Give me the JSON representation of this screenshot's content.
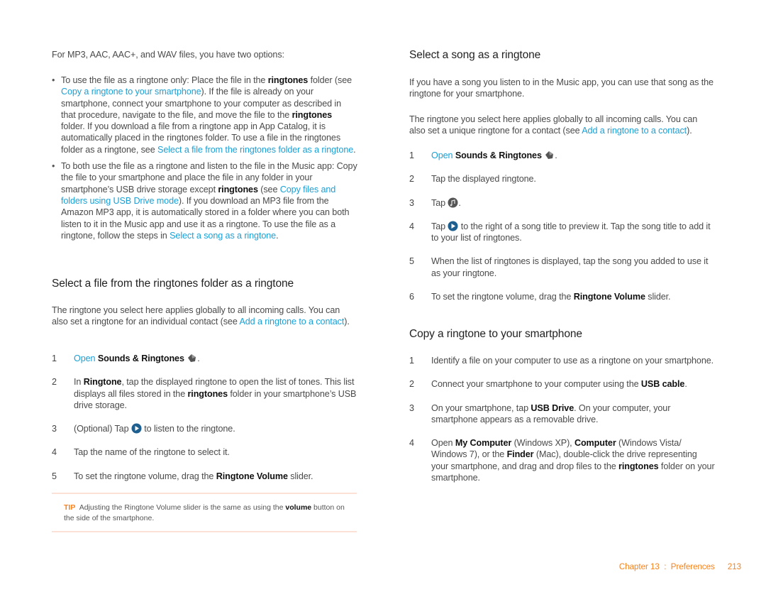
{
  "left": {
    "intro": "For MP3, AAC, AAC+, and WAV files, you have two options:",
    "bullet1": {
      "t1": "To use the file as a ringtone only: Place the file in the ",
      "b1": "ringtones",
      "t2": " folder (see ",
      "link1": "Copy a ringtone to your smartphone",
      "t3": "). If the file is already on your smartphone, connect your smartphone to your computer as described in that procedure, navigate to the file, and move the file to the ",
      "b2": "ringtones",
      "t4": " folder. If you download a file from a ringtone app in App Catalog, it is automatically placed in the ringtones folder. To use a file in the ringtones folder as a ringtone, see ",
      "link2": "Select a file from the ringtones folder as a ringtone",
      "t5": "."
    },
    "bullet2": {
      "t1": "To both use the file as a ringtone and listen to the file in the Music app: Copy the file to your smartphone and place the file in any folder in your smartphone’s USB drive storage except ",
      "b1": "ringtones",
      "t2": " (see ",
      "link1": "Copy files and folders using USB Drive mode",
      "t3": "). If you download an MP3 file from the Amazon MP3 app, it is automatically stored in a folder where you can both listen to it in the Music app and use it as a ringtone. To use the file as a ringtone, follow the steps in ",
      "link2": "Select a song as a ringtone",
      "t4": "."
    },
    "section_title": "Select a file from the ringtones folder as a ringtone",
    "section_para": {
      "t1": "The ringtone you select here applies globally to all incoming calls. You can also set a ringtone for an individual contact (see ",
      "link": "Add a ringtone to a contact",
      "t2": ")."
    },
    "steps": {
      "s1": {
        "num": "1",
        "link": "Open",
        "b": "Sounds & Ringtones",
        "icon": "sounds-ringtones-icon",
        "end": "."
      },
      "s2": {
        "num": "2",
        "t1": "In ",
        "b1": "Ringtone",
        "t2": ", tap the displayed ringtone to open the list of tones. This list displays all files stored in the ",
        "b2": "ringtones",
        "t3": " folder in your smartphone’s USB drive storage."
      },
      "s3": {
        "num": "3",
        "t1": "(Optional) Tap ",
        "icon": "play-icon",
        "t2": " to listen to the ringtone."
      },
      "s4": {
        "num": "4",
        "t1": "Tap the name of the ringtone to select it."
      },
      "s5": {
        "num": "5",
        "t1": "To set the ringtone volume, drag the ",
        "b1": "Ringtone Volume",
        "t2": " slider."
      }
    },
    "tip": {
      "label": "TIP",
      "t1": "Adjusting the Ringtone Volume slider is the same as using the ",
      "b1": "volume",
      "t2": " button on the side of the smartphone."
    }
  },
  "right": {
    "section1_title": "Select a song as a ringtone",
    "para1": "If you have a song you listen to in the Music app, you can use that song as the ringtone for your smartphone.",
    "para2": {
      "t1": "The ringtone you select here applies globally to all incoming calls. You can also set a unique ringtone for a contact (see ",
      "link": "Add a ringtone to a contact",
      "t2": ")."
    },
    "steps1": {
      "s1": {
        "num": "1",
        "link": "Open",
        "b": "Sounds & Ringtones",
        "icon": "sounds-ringtones-icon",
        "end": "."
      },
      "s2": {
        "num": "2",
        "t1": "Tap the displayed ringtone."
      },
      "s3": {
        "num": "3",
        "t1": "Tap ",
        "icon": "music-note-icon",
        "t2": "."
      },
      "s4": {
        "num": "4",
        "t1": "Tap ",
        "icon": "play-icon",
        "t2": " to the right of a song title to preview it. Tap the song title to add it to your list of ringtones."
      },
      "s5": {
        "num": "5",
        "t1": "When the list of ringtones is displayed, tap the song you added to use it as your ringtone."
      },
      "s6": {
        "num": "6",
        "t1": "To set the ringtone volume, drag the ",
        "b1": "Ringtone Volume",
        "t2": " slider."
      }
    },
    "section2_title": "Copy a ringtone to your smartphone",
    "steps2": {
      "s1": {
        "num": "1",
        "t1": "Identify a file on your computer to use as a ringtone on your smartphone."
      },
      "s2": {
        "num": "2",
        "t1": "Connect your smartphone to your computer using the ",
        "b1": "USB cable",
        "t2": "."
      },
      "s3": {
        "num": "3",
        "t1": "On your smartphone, tap ",
        "b1": "USB Drive",
        "t2": ". On your computer, your smartphone appears as a removable drive."
      },
      "s4": {
        "num": "4",
        "t1": "Open ",
        "b1": "My Computer",
        "t2": " (Windows XP), ",
        "b2": "Computer",
        "t3": " (Windows Vista/ Windows 7), or the ",
        "b3": "Finder",
        "t4": " (Mac), double-click the drive representing your smartphone, and drag and drop files to the ",
        "b4": "ringtones",
        "t5": " folder on your smartphone."
      }
    }
  },
  "footer": {
    "chapter": "Chapter 13  :  Preferences",
    "page": "213"
  },
  "colors": {
    "link": "#1aa0d6",
    "accent": "#f5821f",
    "rule": "#fbe1d6"
  }
}
